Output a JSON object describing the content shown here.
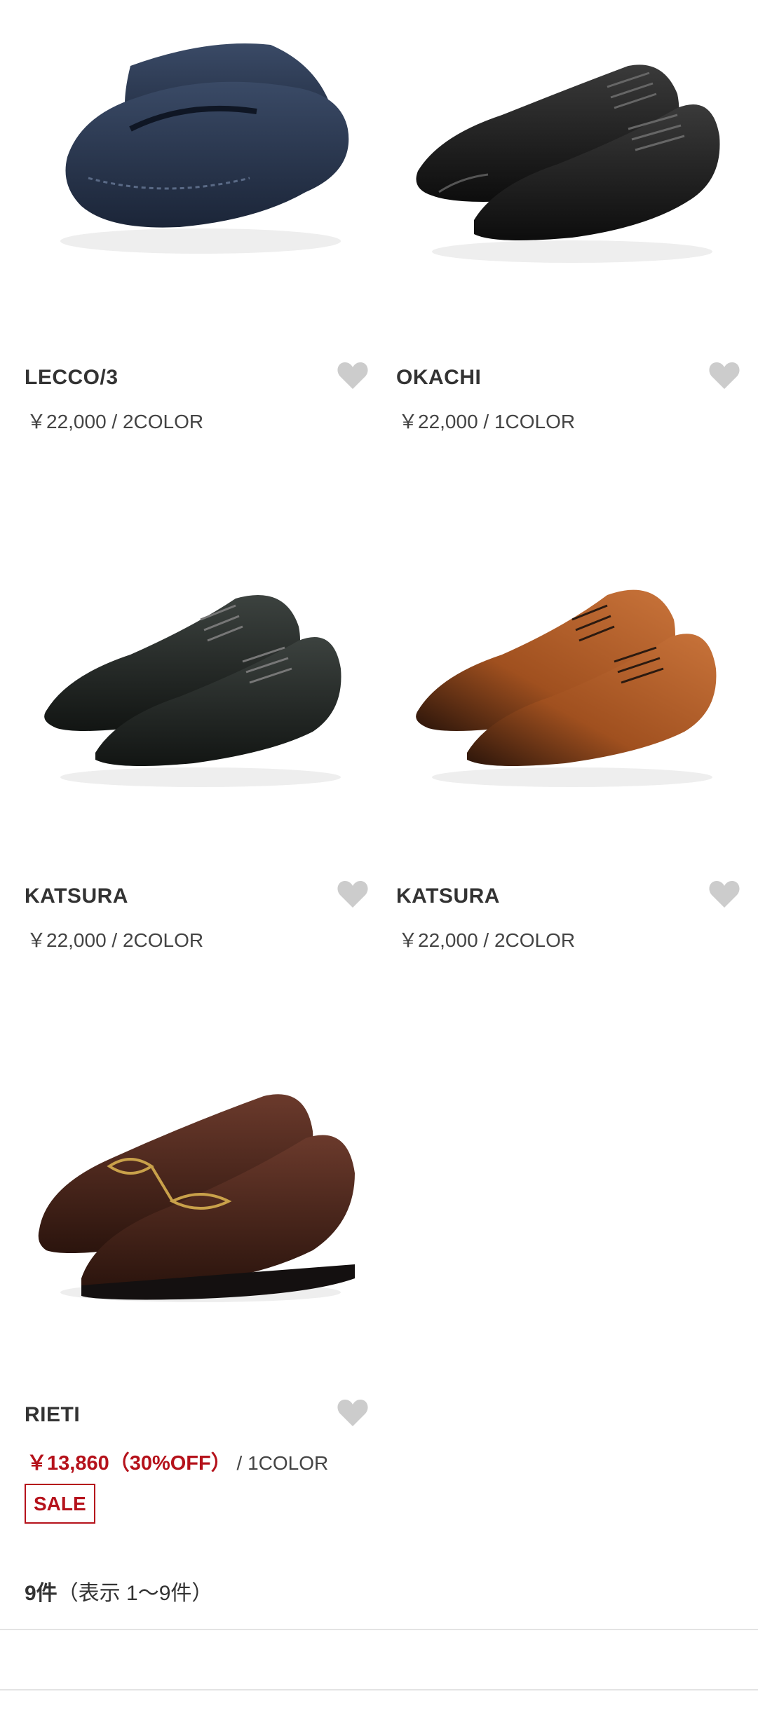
{
  "products": [
    {
      "name": "LECCO/3",
      "price": "￥22,000 / 2COLOR",
      "image": "navy-suede-driving-loafer",
      "favorite_icon": "heart-icon"
    },
    {
      "name": "OKACHI",
      "price": "￥22,000 / 1COLOR",
      "image": "black-leather-cap-toe-derby",
      "favorite_icon": "heart-icon"
    },
    {
      "name": "KATSURA",
      "price": "￥22,000 / 2COLOR",
      "image": "black-leather-oxford",
      "favorite_icon": "heart-icon"
    },
    {
      "name": "KATSURA",
      "price": "￥22,000 / 2COLOR",
      "image": "brown-leather-oxford",
      "favorite_icon": "heart-icon"
    },
    {
      "name": "RIETI",
      "sale_price": "￥13,860",
      "discount": "（30%OFF）",
      "colors": "/ 1COLOR",
      "badge": "SALE",
      "image": "brown-bit-loafer",
      "favorite_icon": "heart-icon"
    }
  ],
  "result_count": {
    "count": "9件",
    "range": "（表示 1〜9件）"
  },
  "colors": {
    "sale": "#b5121b",
    "heart": "#cccccc",
    "text": "#333333"
  }
}
